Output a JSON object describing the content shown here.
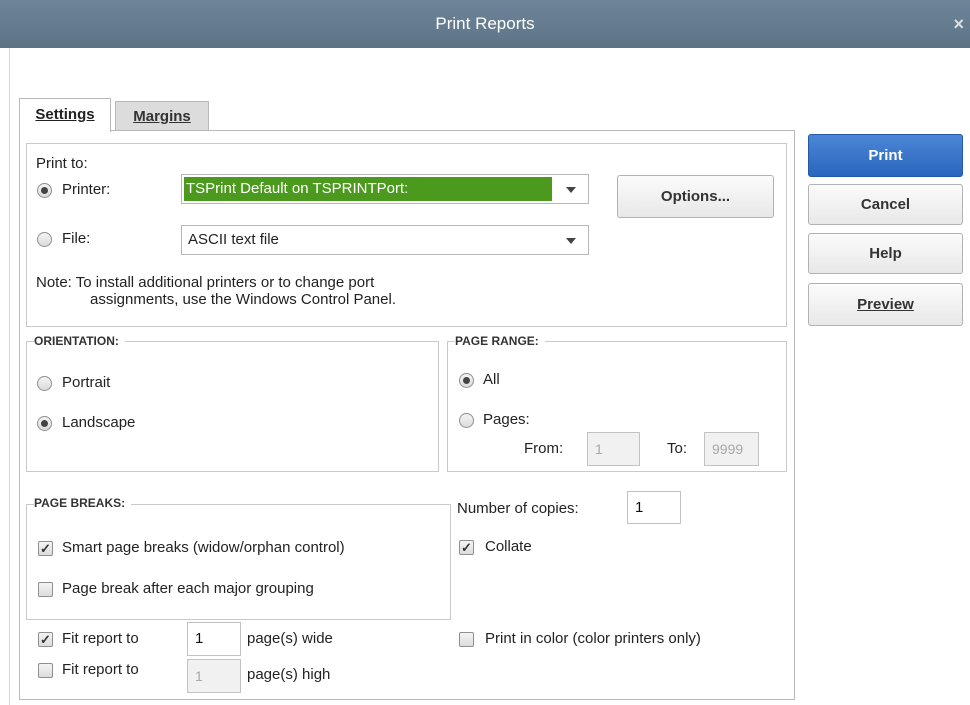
{
  "window": {
    "title": "Print Reports",
    "close_glyph": "×"
  },
  "tabs": {
    "settings": "Settings",
    "margins": "Margins"
  },
  "print_to": {
    "label": "Print to:",
    "printer_label": "Printer:",
    "printer_value": "TSPrint Default on TSPRINTPort:",
    "printer_selected": true,
    "file_label": "File:",
    "file_value": "ASCII text file",
    "note_line1": "Note: To install additional printers or to change port",
    "note_line2": "assignments, use the Windows Control Panel.",
    "options_button": "Options..."
  },
  "orientation": {
    "legend": "ORIENTATION:",
    "portrait": "Portrait",
    "landscape": "Landscape",
    "selected": "landscape"
  },
  "page_range": {
    "legend": "PAGE RANGE:",
    "all": "All",
    "pages": "Pages:",
    "from_label": "From:",
    "from_value": "1",
    "to_label": "To:",
    "to_value": "9999",
    "selected": "all"
  },
  "page_breaks": {
    "legend": "PAGE BREAKS:",
    "smart": "Smart page breaks (widow/orphan control)",
    "smart_checked": true,
    "major": "Page break after each major grouping",
    "major_checked": false
  },
  "copies": {
    "label": "Number of copies:",
    "value": "1",
    "collate": "Collate",
    "collate_checked": true
  },
  "fit": {
    "wide_label": "Fit report to",
    "wide_value": "1",
    "wide_suffix": "page(s) wide",
    "wide_checked": true,
    "high_label": "Fit report to",
    "high_value": "1",
    "high_suffix": "page(s) high",
    "high_checked": false
  },
  "color": {
    "label": "Print in color (color printers only)",
    "checked": false
  },
  "buttons": {
    "print": "Print",
    "cancel": "Cancel",
    "help": "Help",
    "preview": "Preview"
  },
  "colors": {
    "title_bar": "#6e8599",
    "selection": "#4b9a1e",
    "primary_button": "#2a66bd"
  }
}
